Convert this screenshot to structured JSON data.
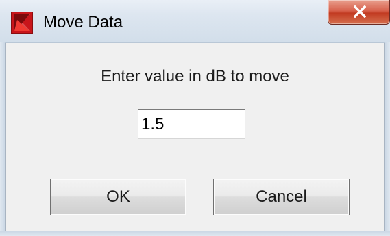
{
  "window": {
    "title": "Move Data",
    "close_label": "x"
  },
  "dialog": {
    "prompt": "Enter value in dB to move",
    "input_value": "1.5",
    "ok_label": "OK",
    "cancel_label": "Cancel"
  },
  "colors": {
    "titlebar": "#dde6f0",
    "client_background": "#f0f0f0",
    "close_button": "#c23b22",
    "app_icon": "#c8151b"
  },
  "icons": {
    "app": "k-logo-icon",
    "close": "close-icon"
  }
}
